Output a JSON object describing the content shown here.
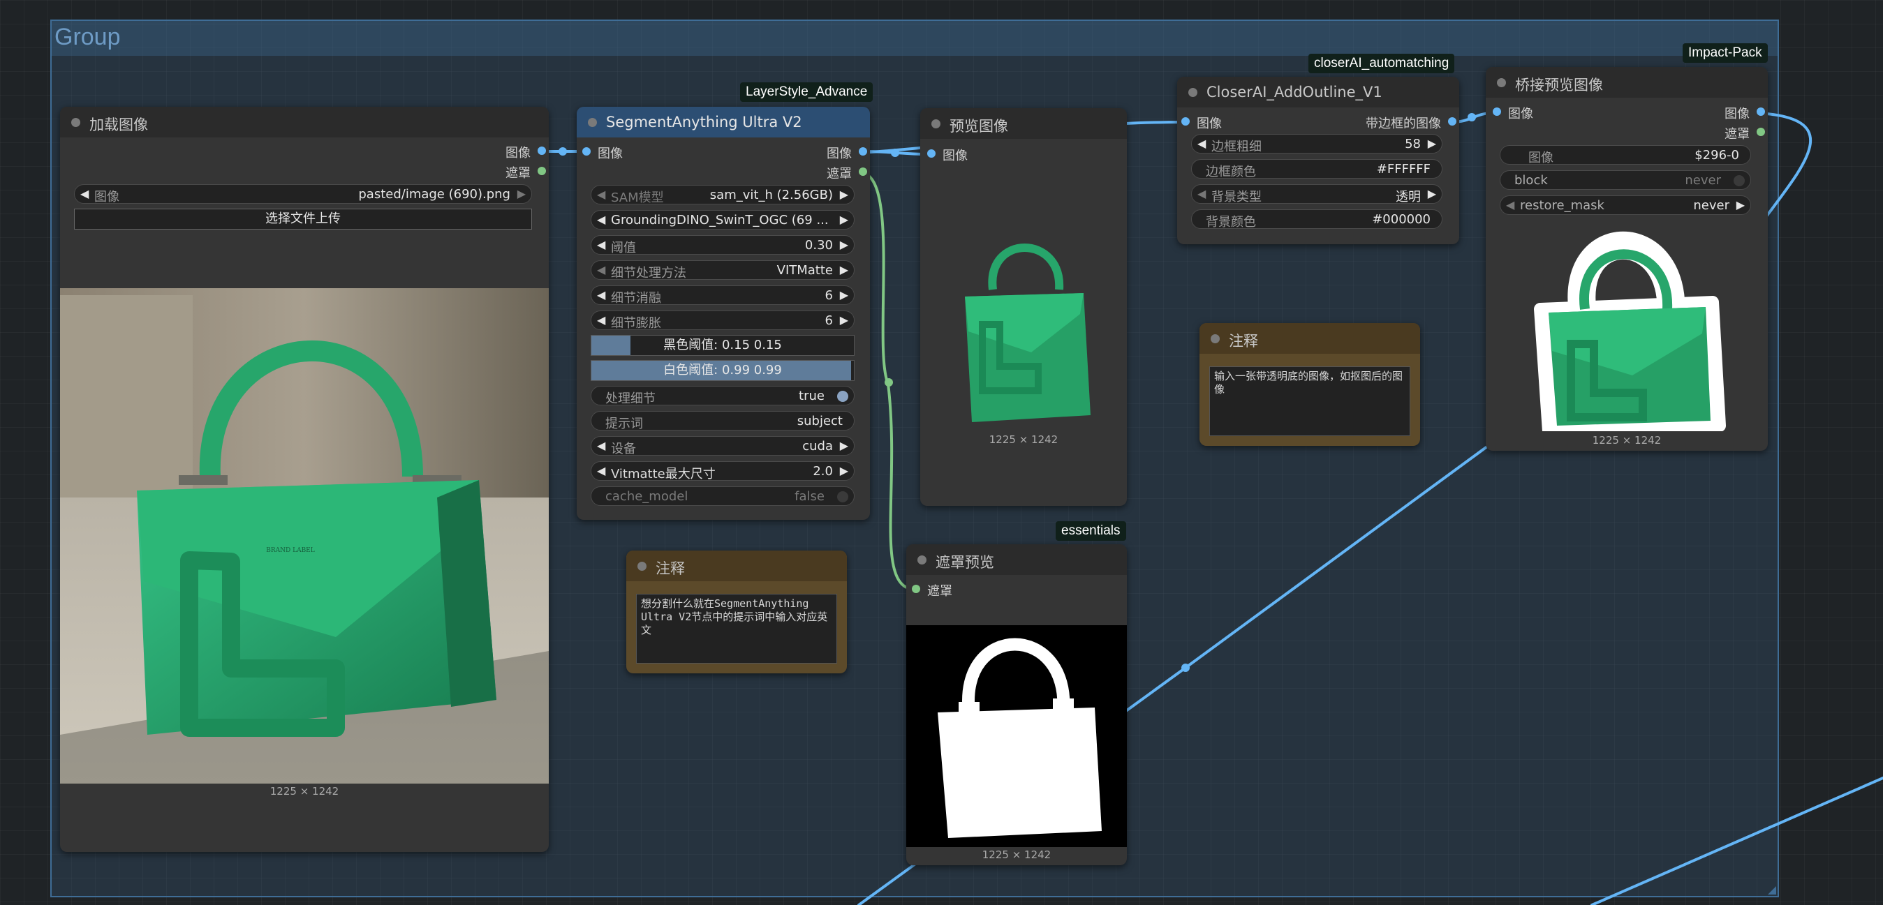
{
  "group": {
    "title": "Group"
  },
  "badges": {
    "layerstyle": "LayerStyle_Advance",
    "closerai": "closerAI_automatching",
    "impact": "Impact-Pack",
    "essentials": "essentials"
  },
  "load_image": {
    "title": "加载图像",
    "out_image": "图像",
    "out_mask": "遮罩",
    "image_label": "图像",
    "image_value": "pasted/image (690).png",
    "upload_label": "选择文件上传",
    "dims": "1225 × 1242"
  },
  "segment": {
    "title": "SegmentAnything Ultra V2",
    "in_image": "图像",
    "out_image": "图像",
    "out_mask": "遮罩",
    "widgets": [
      {
        "label": "SAM模型",
        "value": "sam_vit_h (2.56GB)"
      },
      {
        "label": "GroundingDINO_SwinT_OGC (69 ...",
        "value": ""
      },
      {
        "label": "阈值",
        "value": "0.30"
      },
      {
        "label": "细节处理方法",
        "value": "VITMatte"
      },
      {
        "label": "细节消融",
        "value": "6"
      },
      {
        "label": "细节膨胀",
        "value": "6"
      }
    ],
    "black_point": {
      "text": "黑色阈值: 0.15  0.15",
      "fraction": 0.15
    },
    "white_point": {
      "text": "白色阈值: 0.99  0.99",
      "fraction": 0.99
    },
    "process_detail": {
      "label": "处理细节",
      "value": "true"
    },
    "prompt": {
      "label": "提示词",
      "value": "subject"
    },
    "device": {
      "label": "设备",
      "value": "cuda"
    },
    "max_size": {
      "label": "Vitmatte最大尺寸",
      "value": "2.0"
    },
    "cache_model": {
      "label": "cache_model",
      "value": "false"
    }
  },
  "preview": {
    "title": "预览图像",
    "in_image": "图像",
    "dims": "1225 × 1242"
  },
  "mask_preview": {
    "title": "遮罩预览",
    "in_mask": "遮罩",
    "dims": "1225 × 1242"
  },
  "note1": {
    "title": "注释",
    "text": "想分割什么就在SegmentAnything Ultra V2节点中的提示词中输入对应英文"
  },
  "note2": {
    "title": "注释",
    "text": "输入一张带透明底的图像，如抠图后的图像"
  },
  "outline": {
    "title": "CloserAI_AddOutline_V1",
    "in_image": "图像",
    "out_image": "带边框的图像",
    "widgets": [
      {
        "label": "边框粗细",
        "value": "58"
      },
      {
        "label": "边框颜色",
        "value": "#FFFFFF"
      },
      {
        "label": "背景类型",
        "value": "透明"
      },
      {
        "label": "背景颜色",
        "value": "#000000"
      }
    ]
  },
  "bridge": {
    "title": "桥接预览图像",
    "in_image": "图像",
    "out_image": "图像",
    "out_mask": "遮罩",
    "w_image": {
      "label": "图像",
      "value": "$296-0"
    },
    "w_block": {
      "label": "block",
      "value": "never"
    },
    "w_restore": {
      "label": "restore_mask",
      "value": "never"
    },
    "dims": "1225 × 1242"
  },
  "colors": {
    "image_link": "#64b5f6",
    "mask_link": "#81c784",
    "bag_green": "#2fae73",
    "group_border": "#3f6d96"
  },
  "icons": [
    "bag-photo",
    "bag-thumbnail",
    "mask-silhouette",
    "outlined-bag"
  ]
}
